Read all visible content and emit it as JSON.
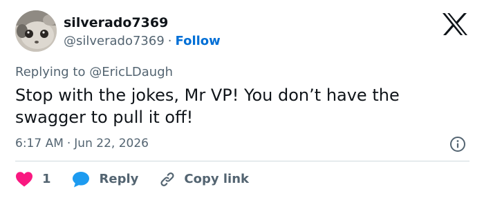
{
  "author": {
    "display_name": "silverado7369",
    "handle": "@silverado7369",
    "separator": "·",
    "follow_label": "Follow"
  },
  "reply_context": {
    "prefix": "Replying to",
    "mention": "@EricLDaugh"
  },
  "tweet": {
    "text": "Stop with the jokes, Mr VP! You don’t have the swagger to pull it off!",
    "time": "6:17 AM",
    "separator": "·",
    "date": "Jun 22, 2026"
  },
  "actions": {
    "like_count": "1",
    "reply_label": "Reply",
    "copy_label": "Copy link"
  },
  "icons": {
    "platform": "x-logo-icon",
    "info": "info-icon",
    "like": "heart-icon",
    "reply": "speech-bubble-icon",
    "copy": "link-icon"
  },
  "colors": {
    "like": "#f91880",
    "reply": "#1d9bf0",
    "follow": "#006fd6",
    "secondary_text": "#536471"
  }
}
